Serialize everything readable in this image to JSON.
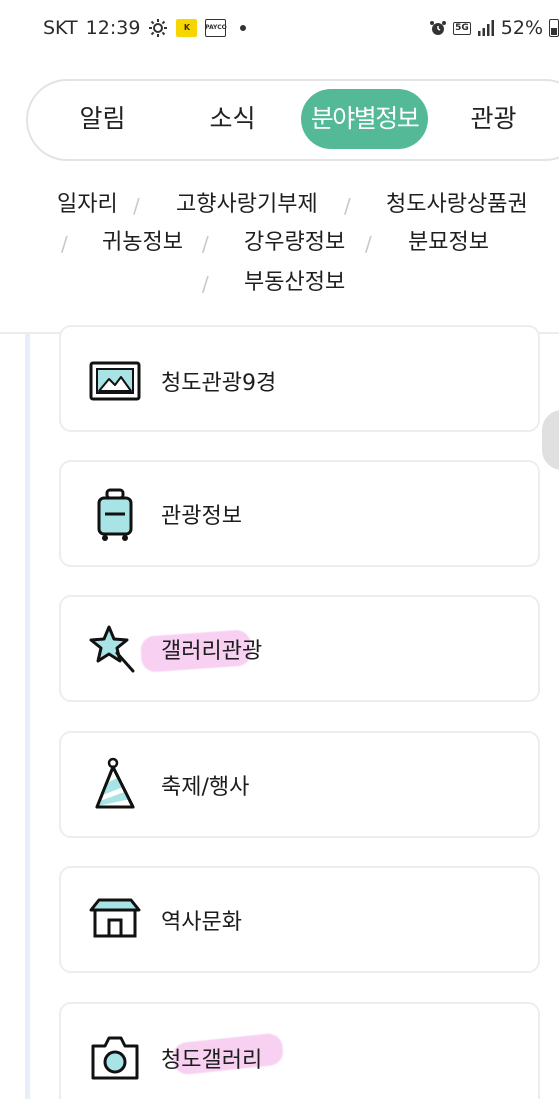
{
  "status_bar": {
    "carrier": "SKT",
    "time": "12:39",
    "icons_left": [
      "settings-gear-icon",
      "kakao-chip-icon",
      "payco-chip-icon"
    ],
    "kakao_chip_text": "K",
    "payco_chip_text": "PAYCO",
    "network": "5G",
    "battery": "52%"
  },
  "tabs": [
    {
      "label": "알림",
      "active": false
    },
    {
      "label": "소식",
      "active": false
    },
    {
      "label": "분야별정보",
      "active": true
    },
    {
      "label": "관광",
      "active": false
    }
  ],
  "subcategories": [
    "일자리",
    "고향사랑기부제",
    "청도사랑상품권",
    "귀농정보",
    "강우량정보",
    "분묘정보",
    "부동산정보"
  ],
  "separator": "/",
  "menu_cards": [
    {
      "label": "청도관광9경",
      "icon": "landscape-picture-icon"
    },
    {
      "label": "관광정보",
      "icon": "suitcase-icon"
    },
    {
      "label": "갤러리관광",
      "icon": "star-wand-icon"
    },
    {
      "label": "축제/행사",
      "icon": "party-hat-icon"
    },
    {
      "label": "역사문화",
      "icon": "traditional-house-icon"
    },
    {
      "label": "청도갤러리",
      "icon": "camera-icon"
    }
  ],
  "colors": {
    "accent": "#54b996",
    "icon_fill": "#a8e3e6",
    "highlight": "#f6c8f0"
  }
}
